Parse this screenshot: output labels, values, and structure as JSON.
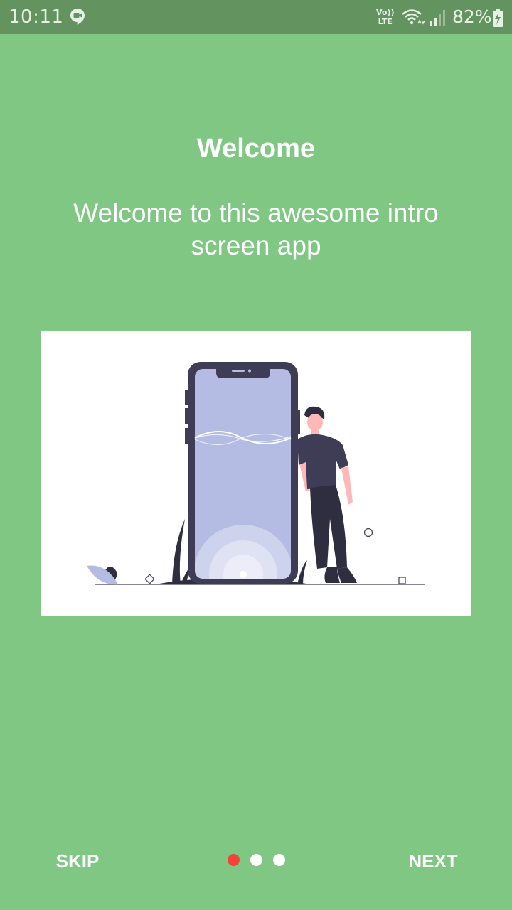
{
  "status_bar": {
    "time": "10:11",
    "volte_top": "Vo))",
    "volte_bottom": "LTE",
    "battery_percent": "82%",
    "icons": [
      "hangouts-icon",
      "volte-icon",
      "wifi-icon",
      "signal-icon",
      "battery-charging-icon"
    ]
  },
  "intro": {
    "title": "Welcome",
    "description": "Welcome to this awesome intro screen app",
    "illustration": "person-leaning-on-phone-illustration"
  },
  "footer": {
    "skip_label": "SKIP",
    "next_label": "NEXT",
    "page_count": 3,
    "current_page": 1
  },
  "colors": {
    "background": "#81C784",
    "status_bar": "#63945F",
    "dot_active": "#F44336",
    "dot_inactive": "#FFFFFF",
    "text": "#FFFFFF"
  }
}
